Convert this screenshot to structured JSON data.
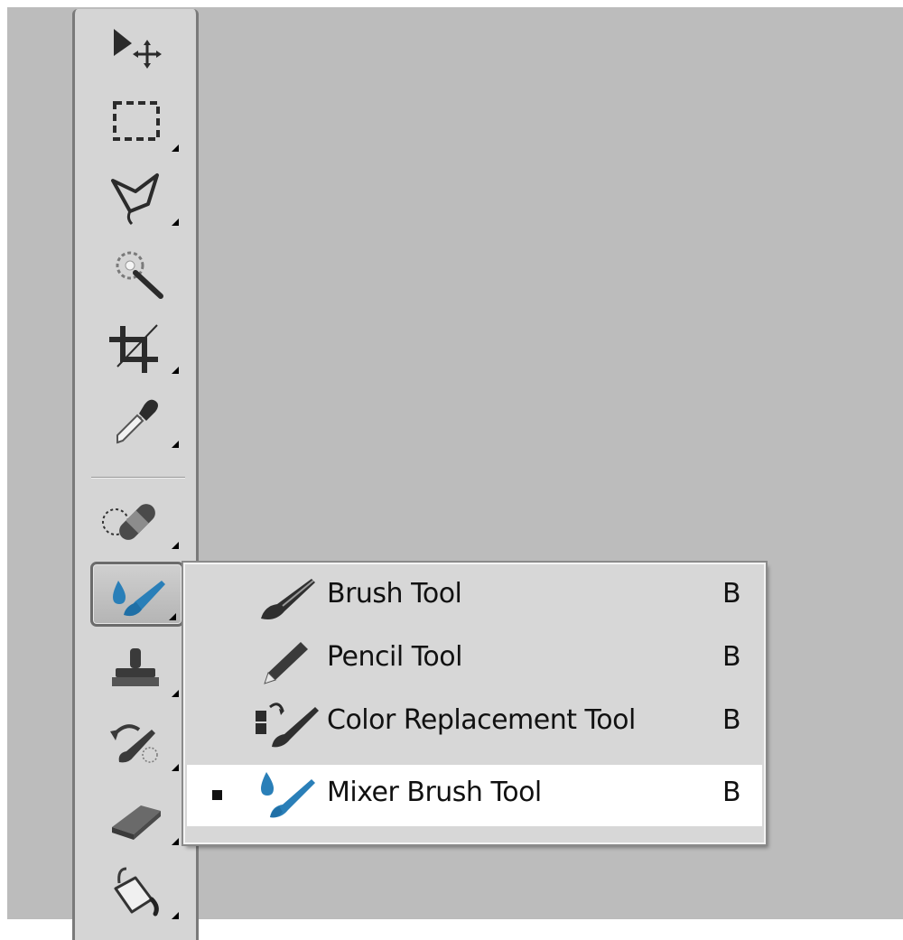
{
  "toolbar": {
    "tools": [
      {
        "name": "move-tool",
        "icon": "move-icon",
        "active": false
      },
      {
        "name": "rectangular-marquee-tool",
        "icon": "marquee-icon",
        "active": false
      },
      {
        "name": "lasso-tool",
        "icon": "polygonal-lasso-icon",
        "active": false
      },
      {
        "name": "quick-selection-tool",
        "icon": "magic-wand-icon",
        "active": false
      },
      {
        "name": "crop-tool",
        "icon": "crop-icon",
        "active": false
      },
      {
        "name": "eyedropper-tool",
        "icon": "eyedropper-icon",
        "active": false
      },
      {
        "name": "healing-brush-tool",
        "icon": "bandage-icon",
        "active": false
      },
      {
        "name": "mixer-brush-tool",
        "icon": "mixer-brush-icon",
        "active": true
      },
      {
        "name": "clone-stamp-tool",
        "icon": "stamp-icon",
        "active": false
      },
      {
        "name": "history-brush-tool",
        "icon": "history-brush-icon",
        "active": false
      },
      {
        "name": "eraser-tool",
        "icon": "eraser-icon",
        "active": false
      },
      {
        "name": "paint-bucket-tool",
        "icon": "paint-bucket-icon",
        "active": false
      }
    ]
  },
  "flyout": {
    "items": [
      {
        "label": "Brush Tool",
        "shortcut": "B",
        "icon": "brush-icon",
        "selected": false
      },
      {
        "label": "Pencil Tool",
        "shortcut": "B",
        "icon": "pencil-icon",
        "selected": false
      },
      {
        "label": "Color Replacement Tool",
        "shortcut": "B",
        "icon": "color-replacement-icon",
        "selected": false
      },
      {
        "label": "Mixer Brush Tool",
        "shortcut": "B",
        "icon": "mixer-brush-icon",
        "selected": true
      }
    ]
  },
  "colors": {
    "workspace": "#bcbcbc",
    "toolbar": "#d5d5d5",
    "flyout": "#d7d7d7",
    "selected_row": "#ffffff",
    "mixer_blue": "#2a7fb8"
  }
}
